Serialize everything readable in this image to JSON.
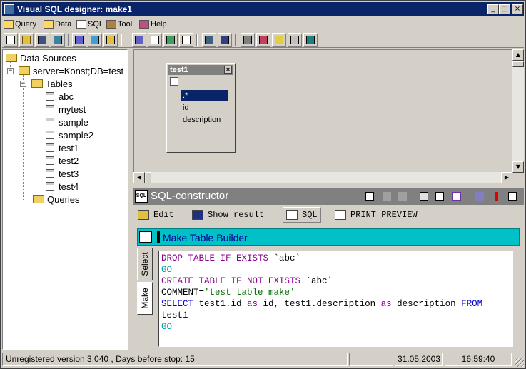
{
  "window": {
    "title": "Visual SQL designer: make1",
    "controls": [
      "_",
      "□",
      "×"
    ]
  },
  "menu": [
    {
      "label": "Query",
      "icon": "query-icon"
    },
    {
      "label": "Data",
      "icon": "data-icon"
    },
    {
      "label": "SQL",
      "icon": "sql-icon"
    },
    {
      "label": "Tool",
      "icon": "tool-icon"
    },
    {
      "label": "Help",
      "icon": "help-icon"
    }
  ],
  "tree": {
    "root": "Data Sources",
    "server": "server=Konst;DB=test",
    "tables_label": "Tables",
    "tables": [
      "abc",
      "mytest",
      "sample",
      "sample2",
      "test1",
      "test2",
      "test3",
      "test4"
    ],
    "queries_label": "Queries"
  },
  "designer": {
    "table": {
      "title": "test1",
      "fields": [
        ".*",
        "id",
        "description"
      ],
      "selected": ".*"
    }
  },
  "sql_constructor": {
    "title": "SQL-constructor",
    "tabs": [
      {
        "label": "Edit",
        "icon": "edit-icon"
      },
      {
        "label": "Show result",
        "icon": "grid-icon"
      },
      {
        "label": "SQL",
        "icon": "sql-icon",
        "active": true
      },
      {
        "label": "PRINT PREVIEW",
        "icon": "print-preview-icon"
      }
    ]
  },
  "builder": {
    "title": "Make Table Builder",
    "side_tabs": [
      "Select",
      "Make"
    ],
    "active_side_tab": "Make",
    "sql": [
      [
        [
          "kw",
          "DROP TABLE IF EXISTS"
        ],
        [
          "",
          " `abc`"
        ]
      ],
      [
        [
          "go",
          "GO"
        ]
      ],
      [
        [
          "kw",
          "CREATE TABLE IF NOT EXISTS"
        ],
        [
          "",
          " `abc`"
        ]
      ],
      [
        [
          "",
          "COMMENT="
        ],
        [
          "str",
          "'test table make'"
        ]
      ],
      [
        [
          "kw2",
          "SELECT"
        ],
        [
          "",
          " test1.id "
        ],
        [
          "kw",
          "as"
        ],
        [
          "",
          " id, test1.description "
        ],
        [
          "kw",
          "as"
        ],
        [
          "",
          " description "
        ],
        [
          "kw2",
          "FROM"
        ]
      ],
      [
        [
          "",
          "test1"
        ]
      ],
      [
        [
          "go",
          "GO"
        ]
      ]
    ]
  },
  "status": {
    "version": "Unregistered version 3.040 , Days before stop: 15",
    "empty": "",
    "date": "31.05.2003",
    "time": "16:59:40"
  },
  "colors": {
    "titlebar": "#0a246a",
    "builder_bar": "#00c0c8",
    "keyword": "#8a0090",
    "keyword_blue": "#0000c8",
    "go": "#00a0a0",
    "string": "#007000"
  }
}
